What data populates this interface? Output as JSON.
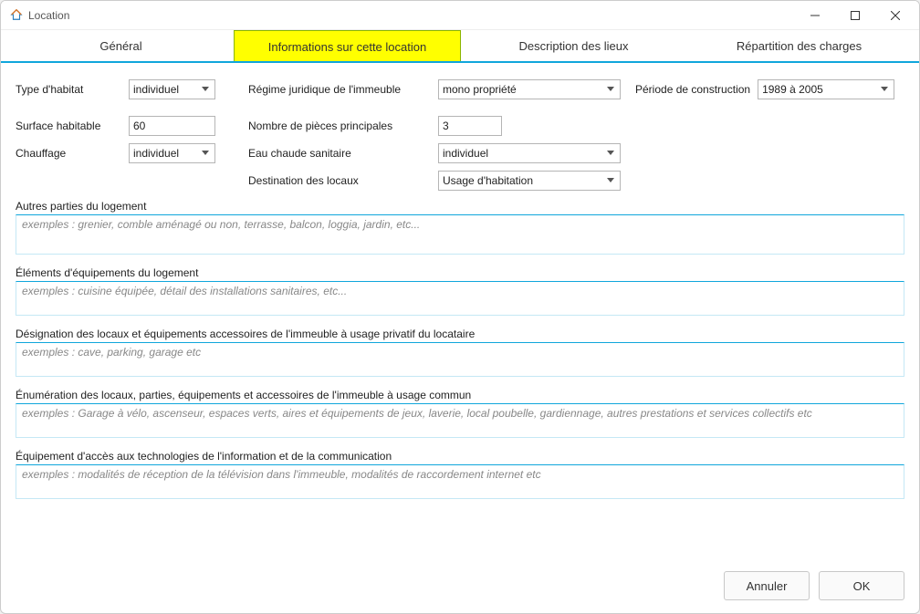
{
  "window": {
    "title": "Location"
  },
  "tabs": {
    "general": "Général",
    "info": "Informations sur cette location",
    "desc": "Description des lieux",
    "charges": "Répartition des charges"
  },
  "labels": {
    "type_habitat": "Type d'habitat",
    "regime": "Régime juridique de l'immeuble",
    "periode": "Période de construction",
    "surface": "Surface habitable",
    "nb_pieces": "Nombre de pièces principales",
    "chauffage": "Chauffage",
    "eau_chaude": "Eau chaude sanitaire",
    "destination": "Destination des locaux"
  },
  "values": {
    "type_habitat": "individuel",
    "regime": "mono propriété",
    "periode": "1989 à 2005",
    "surface": "60",
    "nb_pieces": "3",
    "chauffage": "individuel",
    "eau_chaude": "individuel",
    "destination": "Usage d'habitation"
  },
  "sections": {
    "autres_parties": {
      "label": "Autres parties du logement",
      "placeholder": "exemples : grenier, comble aménagé ou non, terrasse, balcon, loggia, jardin, etc..."
    },
    "elements_equip": {
      "label": "Éléments d'équipements du logement",
      "placeholder": "exemples : cuisine équipée, détail des installations sanitaires, etc..."
    },
    "designation": {
      "label": "Désignation des locaux et équipements accessoires de l'immeuble à usage privatif du locataire",
      "placeholder": "exemples : cave, parking, garage etc"
    },
    "enumeration": {
      "label": "Énumération des locaux, parties, équipements et accessoires de l'immeuble à usage commun",
      "placeholder": "exemples : Garage à vélo, ascenseur, espaces verts, aires et équipements de jeux, laverie, local poubelle, gardiennage, autres prestations et services collectifs etc"
    },
    "equipement_tech": {
      "label": "Équipement d'accès aux technologies de l'information et de la communication",
      "placeholder": "exemples : modalités de réception de la télévision dans l'immeuble, modalités de raccordement internet etc"
    }
  },
  "footer": {
    "cancel": "Annuler",
    "ok": "OK"
  }
}
